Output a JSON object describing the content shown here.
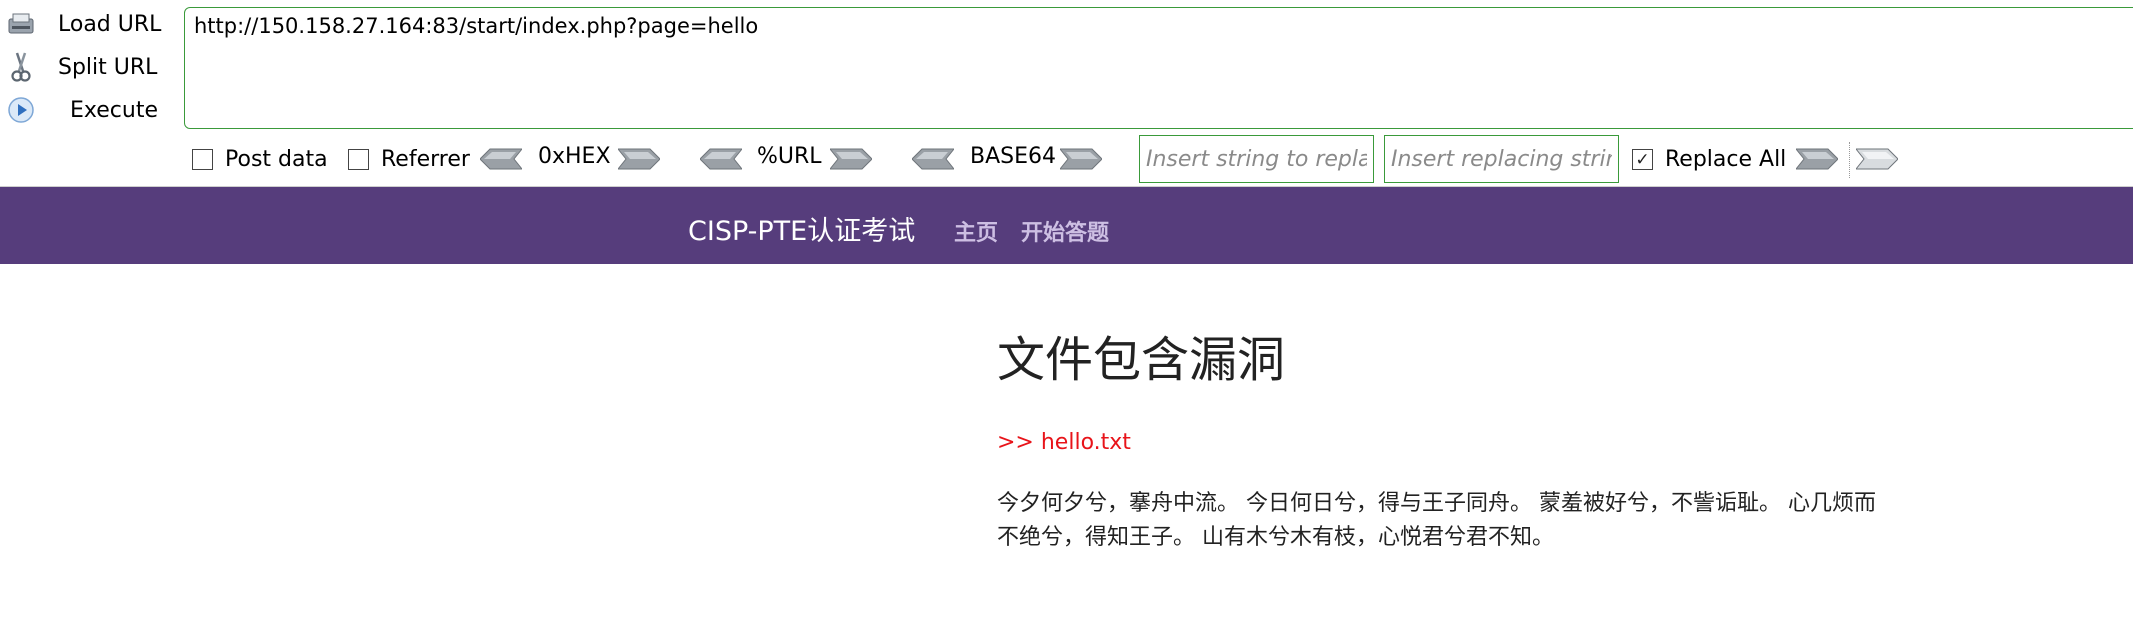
{
  "hackbar": {
    "actions": [
      {
        "label": "Load URL",
        "icon": "load-url-icon"
      },
      {
        "label": "Split URL",
        "icon": "scissors-icon"
      },
      {
        "label": "Execute",
        "icon": "play-icon"
      }
    ],
    "url_value": "http://150.158.27.164:83/start/index.php?page=hello",
    "post_data_label": "Post data",
    "post_data_checked": false,
    "referrer_label": "Referrer",
    "referrer_checked": false,
    "encoders": [
      {
        "label": "0xHEX"
      },
      {
        "label": "%URL"
      },
      {
        "label": "BASE64"
      }
    ],
    "replace_find_placeholder": "Insert string to replace",
    "replace_with_placeholder": "Insert replacing string",
    "replace_all_label": "Replace All",
    "replace_all_checked": true,
    "accent_color": "#3a9a3a"
  },
  "site": {
    "brand": "CISP-PTE认证考试",
    "nav": [
      {
        "label": "主页"
      },
      {
        "label": "开始答题"
      }
    ],
    "nav_color": "#563d7c"
  },
  "content": {
    "title": "文件包含漏洞",
    "file_line": ">> hello.txt",
    "poem": "今夕何夕兮，搴舟中流。 今日何日兮，得与王子同舟。 蒙羞被好兮，不訾诟耻。 心几烦而不绝兮，得知王子。 山有木兮木有枝，心悦君兮君不知。"
  }
}
